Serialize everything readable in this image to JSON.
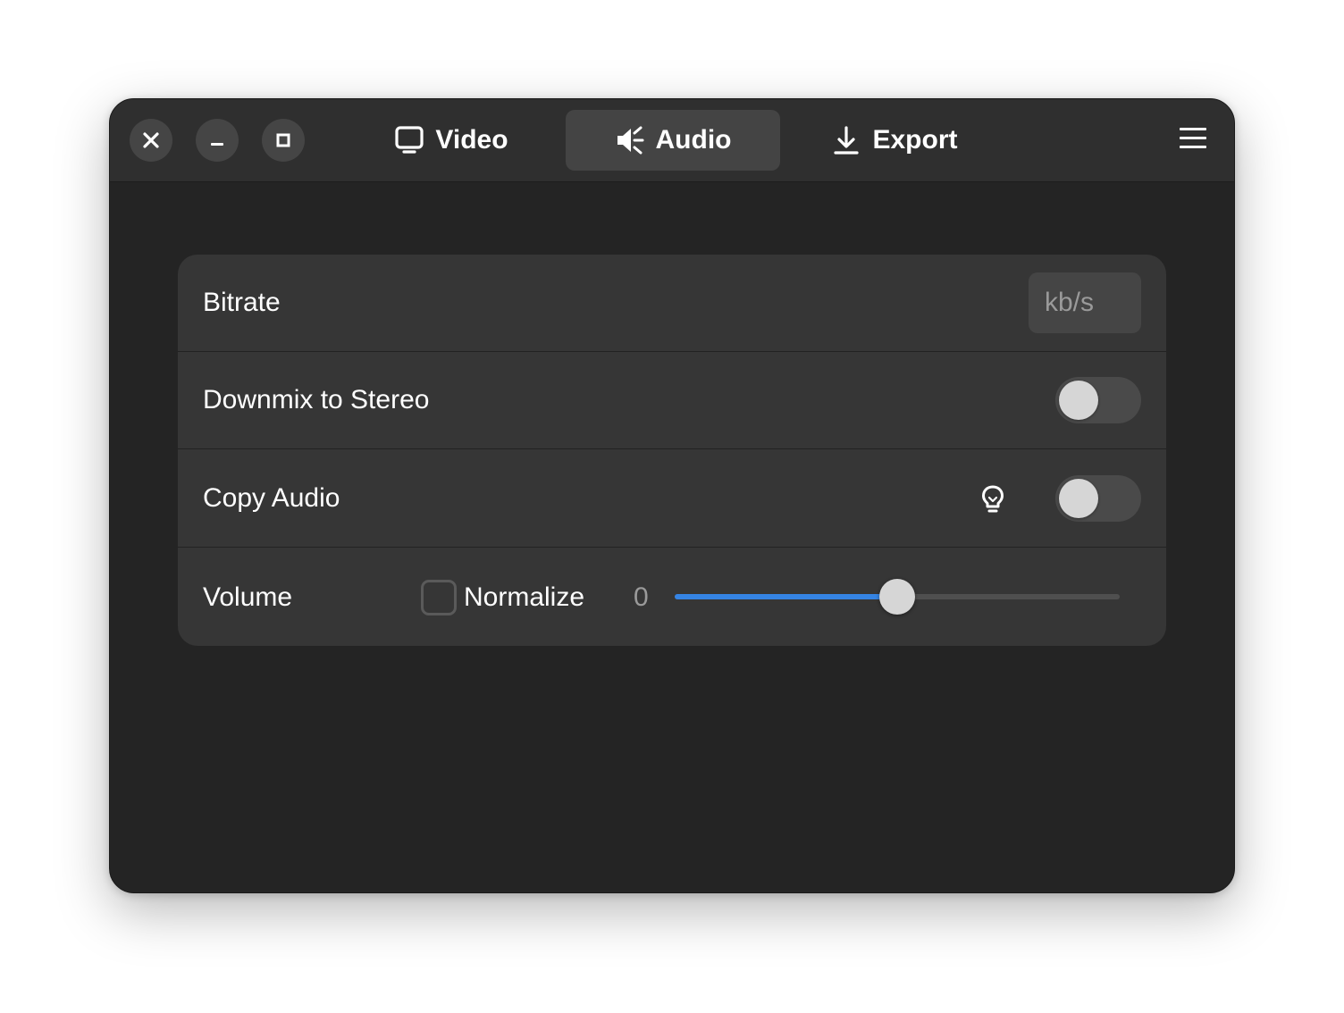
{
  "window": {
    "controls": {
      "close_icon": "close-icon",
      "minimize_icon": "minimize-icon",
      "maximize_icon": "maximize-icon"
    },
    "tabs": [
      {
        "label": "Video",
        "icon": "monitor-icon",
        "active": false
      },
      {
        "label": "Audio",
        "icon": "speaker-icon",
        "active": true
      },
      {
        "label": "Export",
        "icon": "download-icon",
        "active": false
      }
    ],
    "menu_icon": "hamburger-menu-icon"
  },
  "audio_settings": {
    "bitrate": {
      "label": "Bitrate",
      "value": "",
      "placeholder": "kb/s"
    },
    "downmix": {
      "label": "Downmix to Stereo",
      "enabled": false
    },
    "copy_audio": {
      "label": "Copy Audio",
      "hint_icon": "lightbulb-icon",
      "enabled": false
    },
    "volume": {
      "label": "Volume",
      "normalize_label": "Normalize",
      "normalize_checked": false,
      "value": "0",
      "slider_fraction": 0.5
    }
  },
  "colors": {
    "accent": "#3584e4",
    "window_bg": "#242424",
    "headerbar_bg": "#2f2f2f",
    "panel_bg": "#363636"
  }
}
